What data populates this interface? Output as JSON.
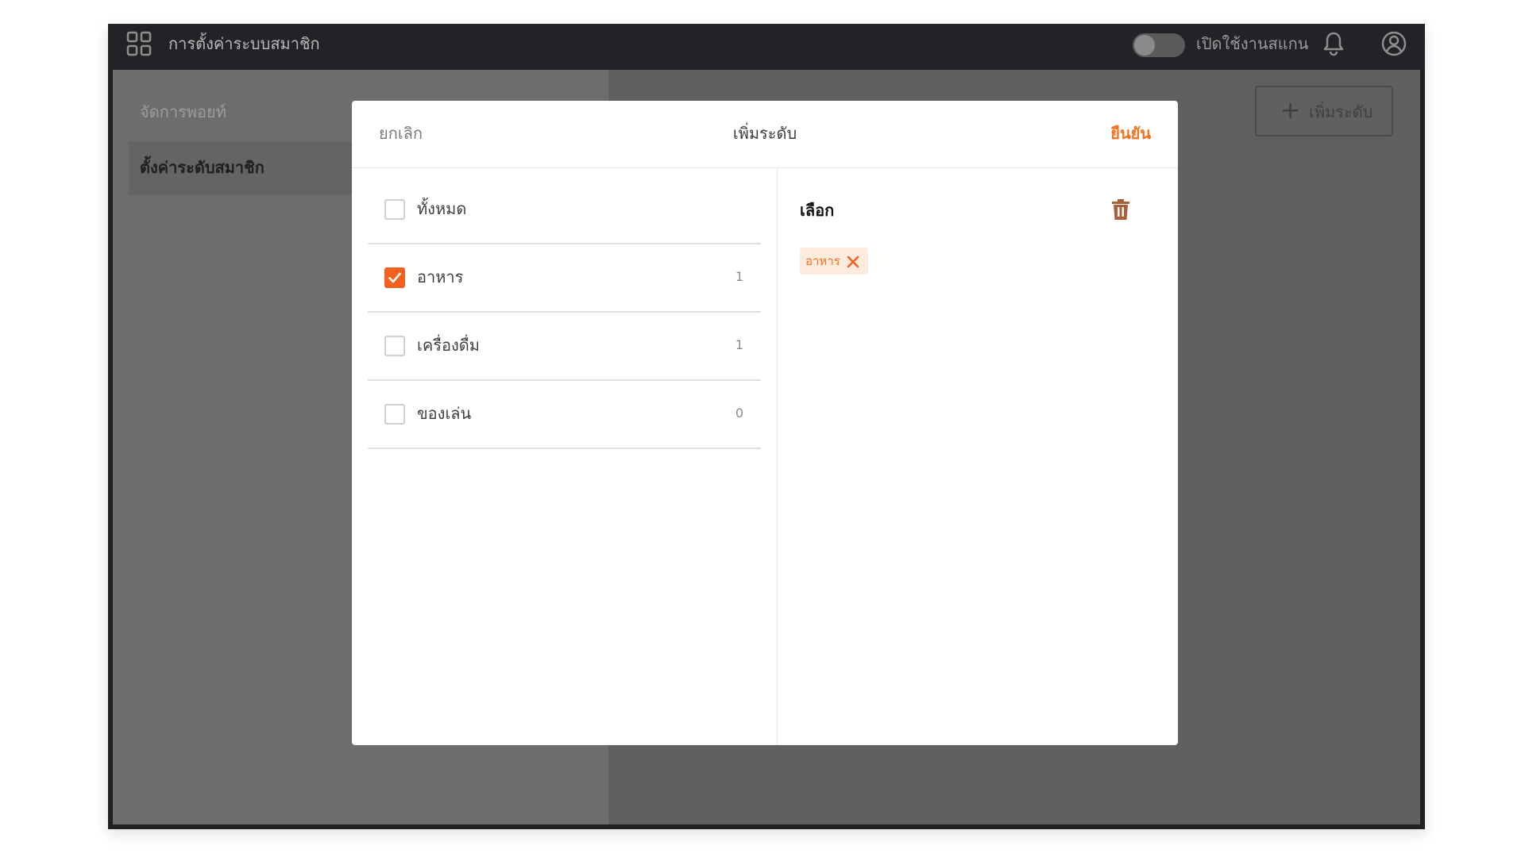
{
  "topbar": {
    "app_title": "การตั้งค่าระบบสมาชิก",
    "scan_label": "เปิดใช้งานสแกน",
    "scan_enabled": false,
    "icons": [
      "grid-icon",
      "bell-icon",
      "user-icon"
    ]
  },
  "sidebar": {
    "items": [
      {
        "label": "จัดการพอยท์",
        "active": false
      },
      {
        "label": "ตั้งค่าระดับสมาชิก",
        "active": true
      }
    ]
  },
  "main": {
    "add_level_label": "เพิ่มระดับ"
  },
  "modal": {
    "cancel_label": "ยกเลิก",
    "title": "เพิ่มระดับ",
    "confirm_label": "ยืนยัน",
    "categories": [
      {
        "label": "ทั้งหมด",
        "count": "",
        "checked": false
      },
      {
        "label": "อาหาร",
        "count": "1",
        "checked": true
      },
      {
        "label": "เครื่องดื่ม",
        "count": "1",
        "checked": false
      },
      {
        "label": "ของเล่น",
        "count": "0",
        "checked": false
      }
    ],
    "selected_title": "เลือก",
    "selected_chips": [
      {
        "label": "อาหาร"
      }
    ]
  },
  "colors": {
    "accent": "#f4711f",
    "checkbox_checked": "#f4601f",
    "chip_bg": "#fdecdd",
    "topbar": "#222326",
    "overlay": "#606060"
  }
}
